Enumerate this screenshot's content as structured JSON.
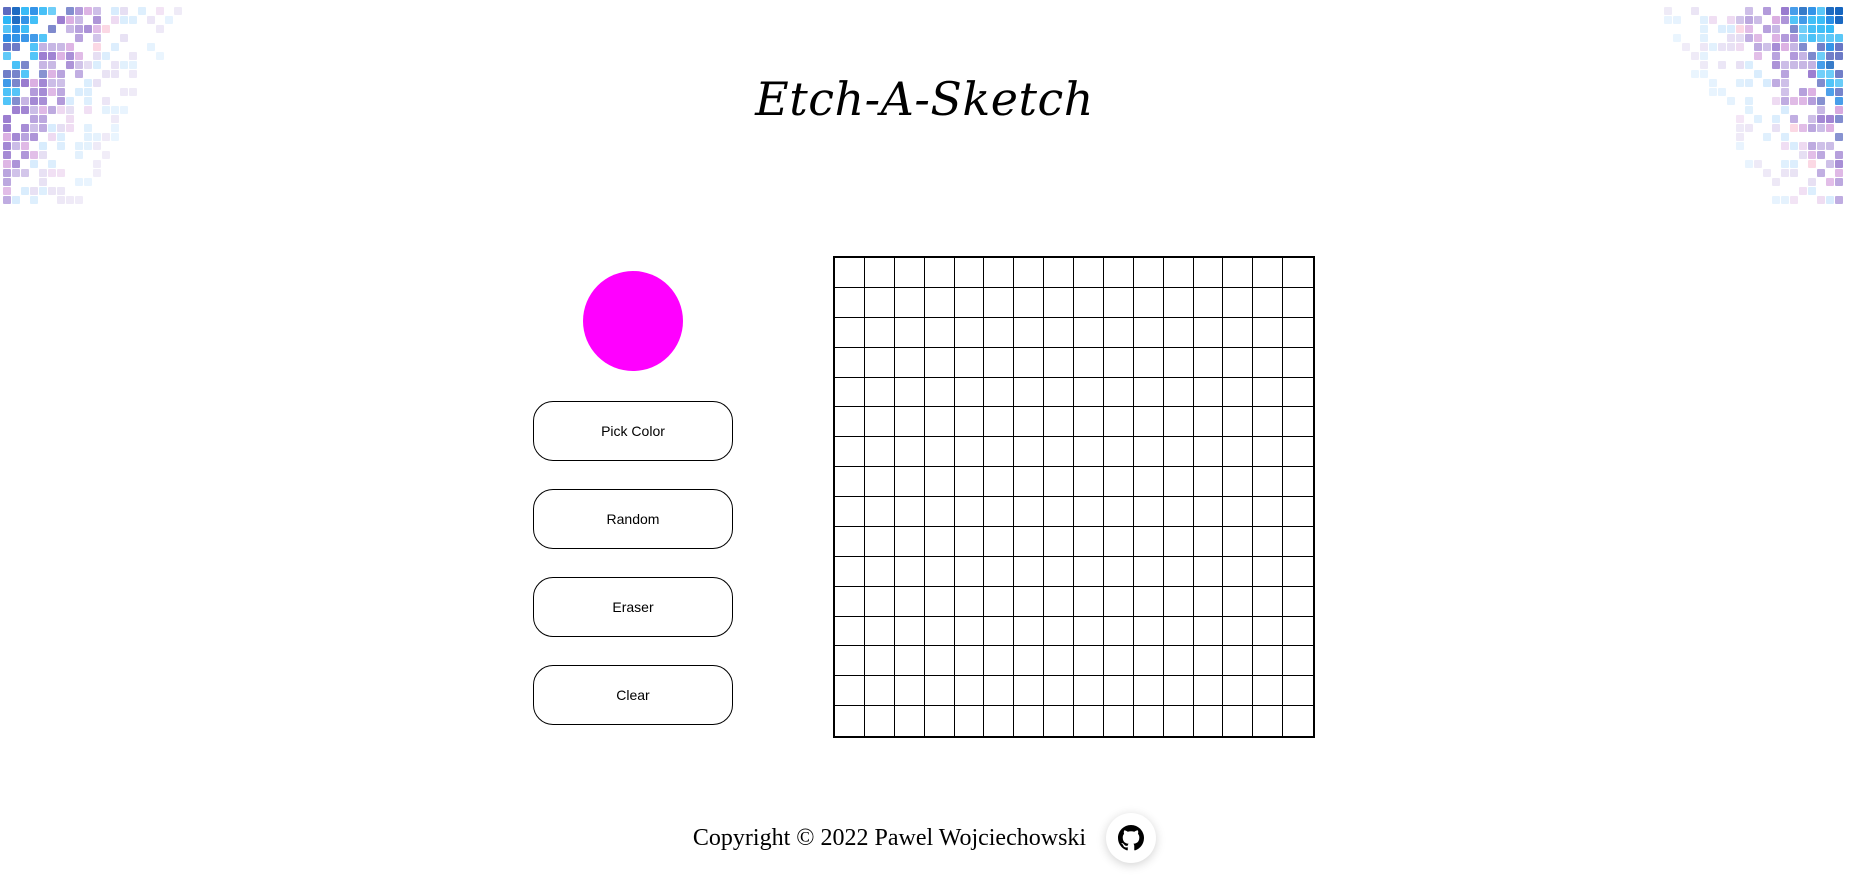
{
  "app": {
    "title": "Etch-A-Sketch"
  },
  "controls": {
    "current_color": "#ff00ff",
    "buttons": {
      "pick_color": "Pick Color",
      "random": "Random",
      "eraser": "Eraser",
      "clear": "Clear"
    }
  },
  "grid": {
    "columns": 16,
    "rows": 16,
    "cell_color": "#ffffff",
    "line_color": "#000000"
  },
  "footer": {
    "copyright": "Copyright © 2022 Pawel Wojciechowski",
    "github_icon": "github-icon"
  },
  "decoration": {
    "corner_palette": [
      "#1565c0",
      "#1e88e5",
      "#29b6f6",
      "#4fc3f7",
      "#5c6bc0",
      "#7e57c2",
      "#9575cd",
      "#b39ddb",
      "#ce93d8",
      "#f8bbd0",
      "#e1bee7",
      "#d1c4e9",
      "#bbdefb"
    ]
  }
}
